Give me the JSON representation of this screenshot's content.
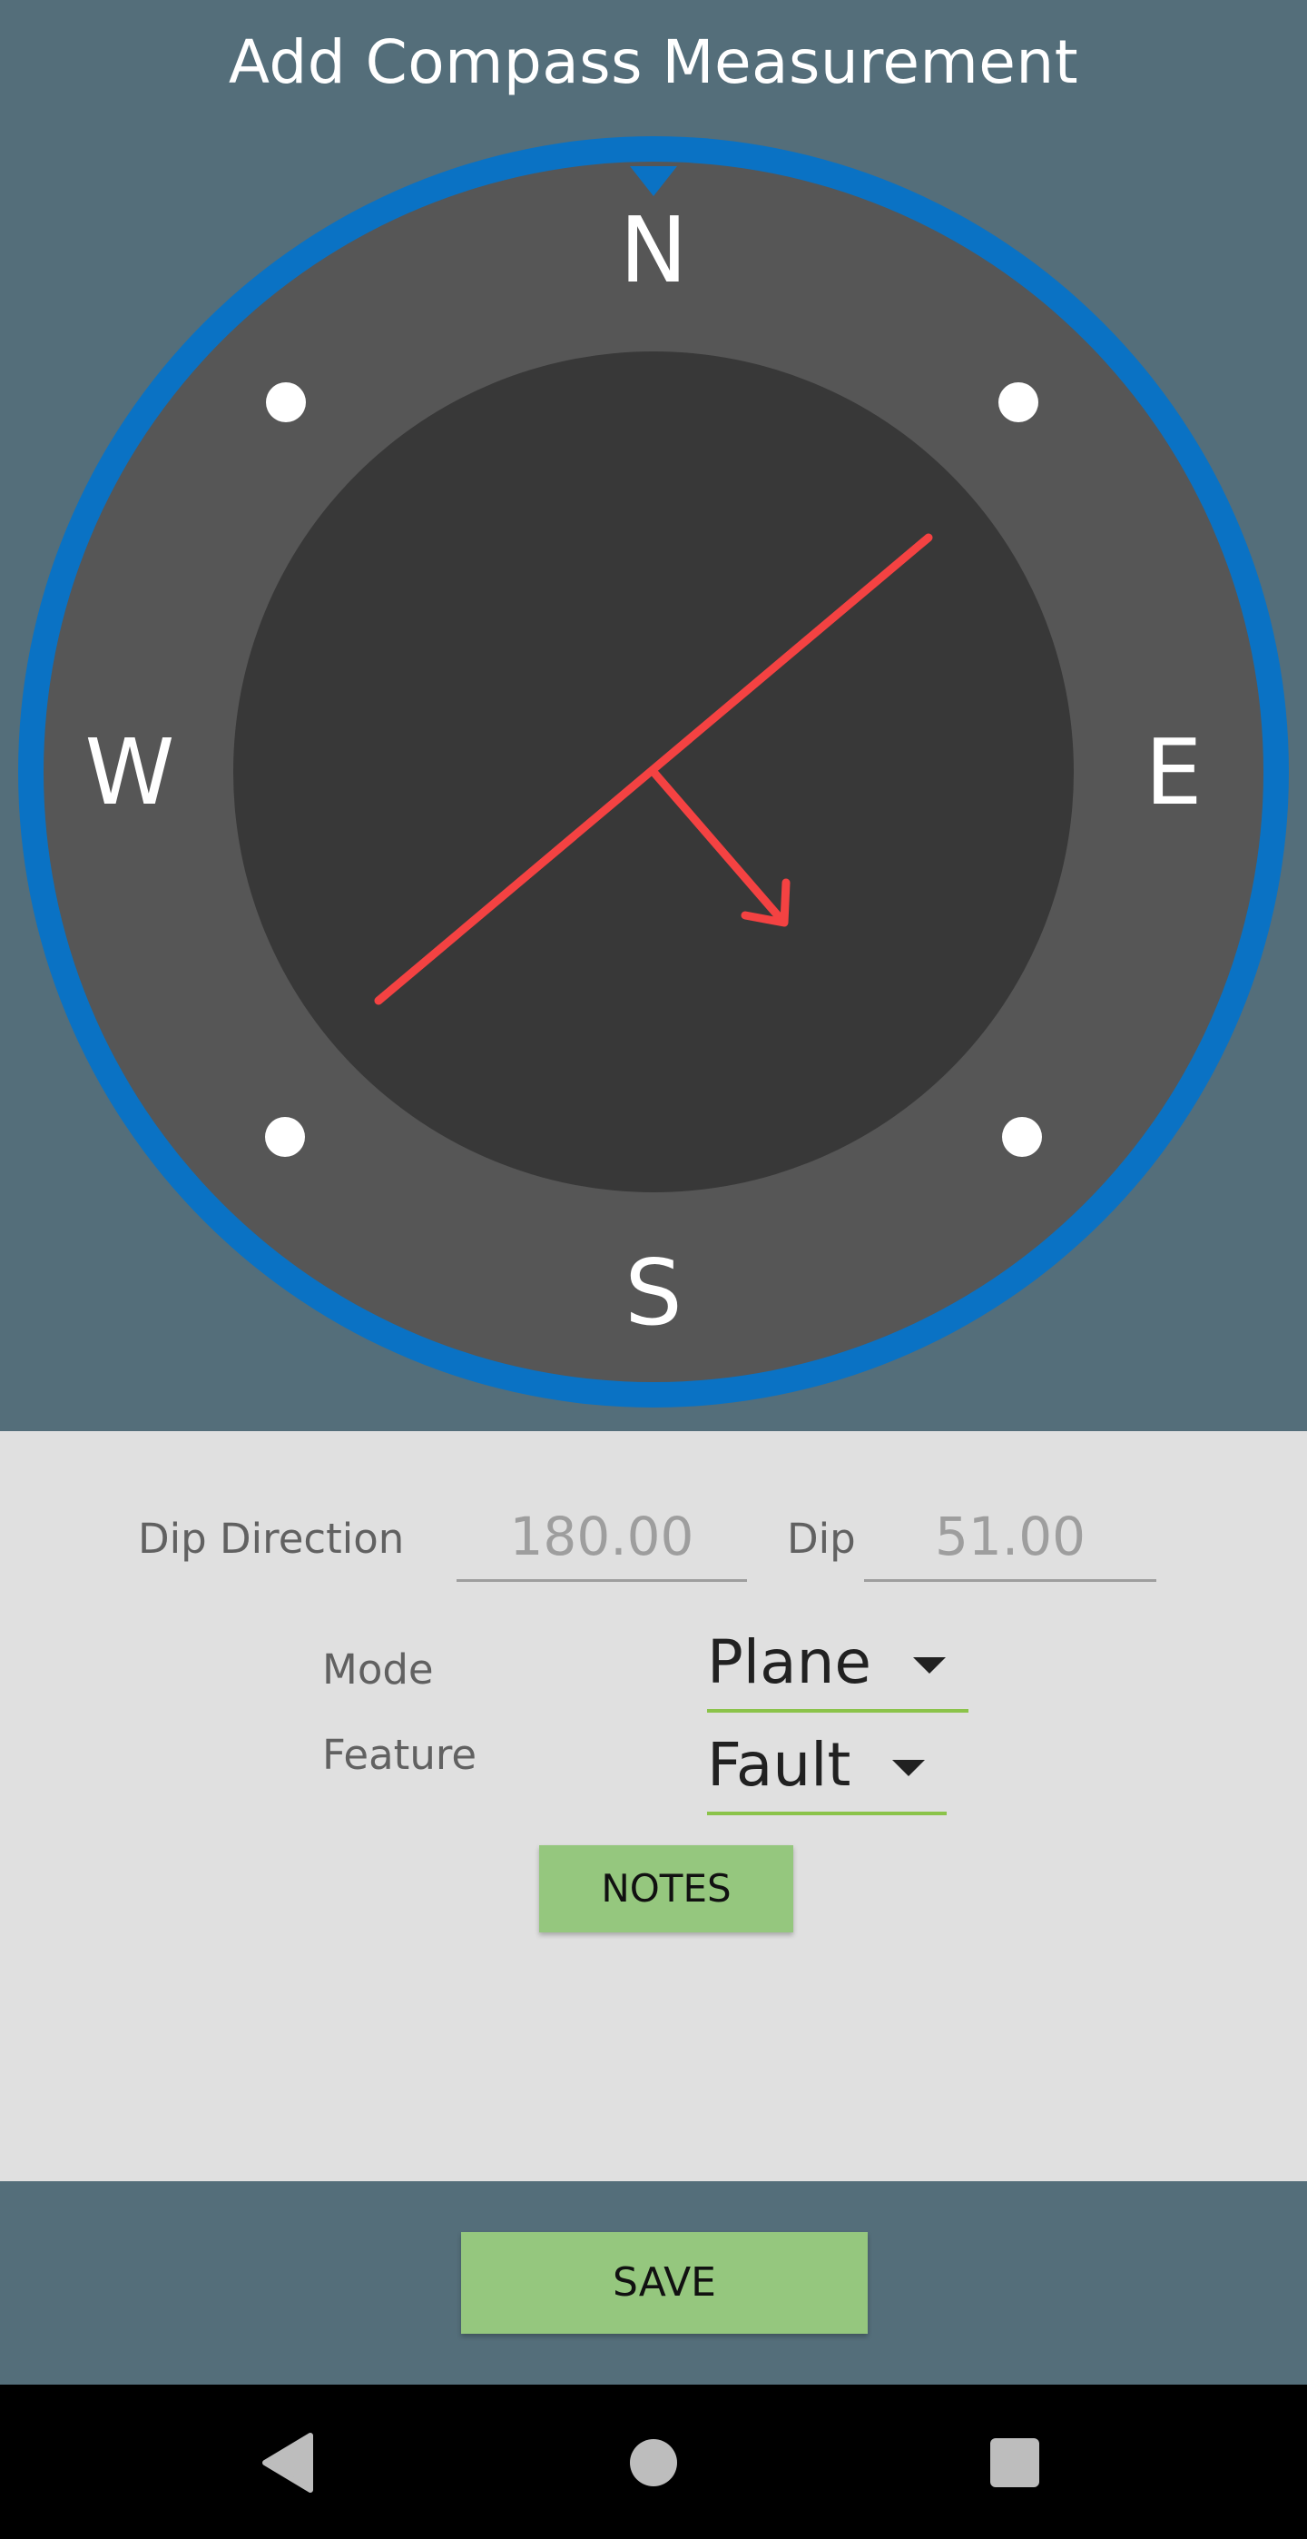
{
  "header": {
    "title": "Add Compass Measurement"
  },
  "compass": {
    "labels": {
      "north": "N",
      "east": "E",
      "south": "S",
      "west": "W"
    },
    "colors": {
      "ring": "#0a72c4",
      "outer_dial": "#565656",
      "inner_dial": "#383838",
      "indicator": "#f44242",
      "marker_dots": "#ffffff"
    }
  },
  "form": {
    "dip_direction": {
      "label": "Dip Direction",
      "value": "180.00"
    },
    "dip": {
      "label": "Dip",
      "value": "51.00"
    },
    "mode": {
      "label": "Mode",
      "selected": "Plane"
    },
    "feature": {
      "label": "Feature",
      "selected": "Fault"
    },
    "notes_button": "NOTES"
  },
  "footer": {
    "save_button": "SAVE"
  },
  "navigation": {
    "back_icon": "back-triangle-icon",
    "home_icon": "home-circle-icon",
    "recents_icon": "recents-square-icon"
  },
  "theme": {
    "background": "#546e7a",
    "form_background": "#e0e0e0",
    "button_green": "#95c77e",
    "accent_green": "#8bc34a"
  }
}
